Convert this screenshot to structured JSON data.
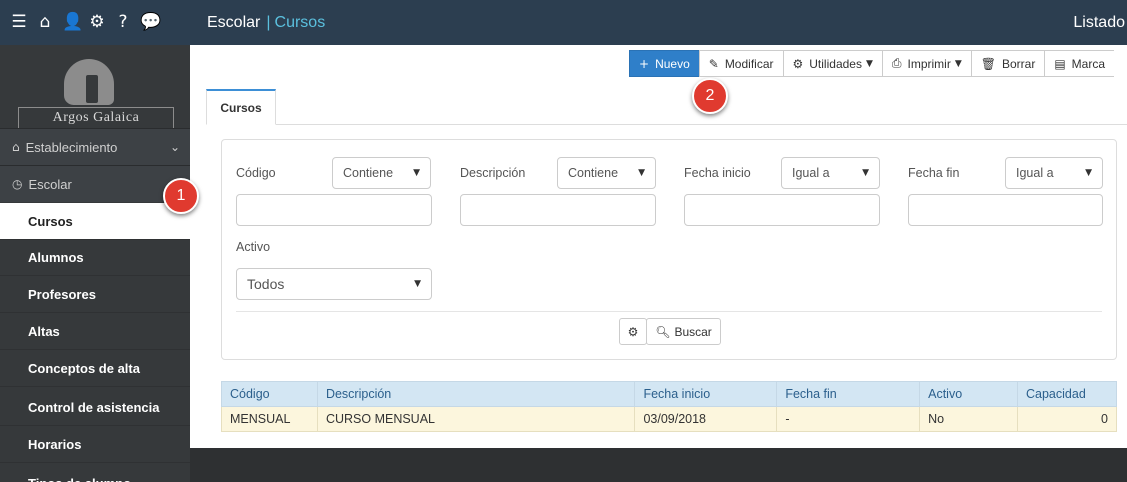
{
  "topbar": {
    "icons": [
      "list-icon",
      "home-icon",
      "user-icon",
      "gear-icon",
      "help-icon",
      "chat-icon"
    ],
    "app_title": "Escolar",
    "separator": "|",
    "module": "Cursos",
    "page_label": "Listado"
  },
  "sidebar": {
    "logo_text": "Argos Galaica",
    "groups": [
      {
        "label": "Establecimiento",
        "icon": "home-icon"
      },
      {
        "label": "Escolar",
        "icon": "clock-icon"
      }
    ],
    "items": [
      {
        "label": "Cursos",
        "active": true
      },
      {
        "label": "Alumnos"
      },
      {
        "label": "Profesores"
      },
      {
        "label": "Altas"
      },
      {
        "label": "Conceptos de alta"
      },
      {
        "label": "Control de asistencia"
      },
      {
        "label": "Horarios"
      },
      {
        "label": "Tipos de alumno"
      }
    ]
  },
  "badges": {
    "first": "1",
    "second": "2"
  },
  "toolbar": {
    "nuevo": "Nuevo",
    "modificar": "Modificar",
    "utilidades": "Utilidades",
    "imprimir": "Imprimir",
    "borrar": "Borrar",
    "marcar": "Marca"
  },
  "tab": {
    "label": "Cursos"
  },
  "filters": {
    "codigo_label": "Código",
    "codigo_op": "Contiene",
    "descripcion_label": "Descripción",
    "descripcion_op": "Contiene",
    "fecha_inicio_label": "Fecha inicio",
    "fecha_inicio_op": "Igual a",
    "fecha_fin_label": "Fecha fin",
    "fecha_fin_op": "Igual a",
    "activo_label": "Activo",
    "activo_value": "Todos",
    "buscar_label": "Buscar"
  },
  "table": {
    "columns": [
      "Código",
      "Descripción",
      "Fecha inicio",
      "Fecha fin",
      "Activo",
      "Capacidad"
    ],
    "rows": [
      [
        "MENSUAL",
        "CURSO MENSUAL",
        "03/09/2018",
        "-",
        "No",
        "0"
      ]
    ]
  },
  "colors": {
    "topbar": "#2c3e50",
    "sidebar": "#36393b",
    "accent": "#2f7fc9",
    "badge": "#e03a2f",
    "table_header": "#d3e6f3",
    "table_row": "#fcf6dd"
  }
}
